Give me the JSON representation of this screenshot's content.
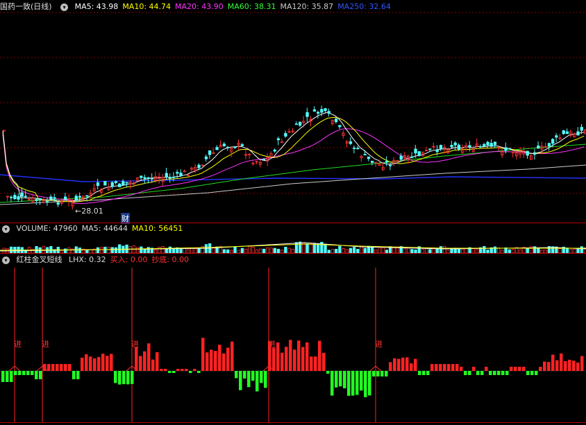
{
  "main": {
    "title": "国药一致(日线)",
    "ma": [
      {
        "label": "MA5: 43.98",
        "color": "#ffffff"
      },
      {
        "label": "MA10: 44.74",
        "color": "#ffff00"
      },
      {
        "label": "MA20: 43.90",
        "color": "#ff33ff"
      },
      {
        "label": "MA60: 38.31",
        "color": "#33ff33"
      },
      {
        "label": "MA120: 35.87",
        "color": "#cccccc"
      },
      {
        "label": "MA250: 32.64",
        "color": "#3355ff"
      }
    ],
    "low_marker": "←28.01",
    "event_marker": "财"
  },
  "volume": {
    "labels": [
      {
        "label": "VOLUME: 47960",
        "color": "#dddddd"
      },
      {
        "label": "MA5: 44644",
        "color": "#dddddd"
      },
      {
        "label": "MA10: 56451",
        "color": "#ffff00"
      }
    ]
  },
  "indicator": {
    "title": "红柱金叉短线",
    "labels": [
      {
        "label": "LHX: 0.32",
        "color": "#dddddd"
      },
      {
        "label": "买入: 0.00",
        "color": "#ff3333"
      },
      {
        "label": "抄底: 0.00",
        "color": "#ff3333"
      }
    ],
    "signal_text": "进"
  },
  "colors": {
    "up": "#ff3333",
    "down": "#54ffff",
    "grid": "#8b0000",
    "osc_up": "#ff2222",
    "osc_down": "#22ff22"
  }
}
